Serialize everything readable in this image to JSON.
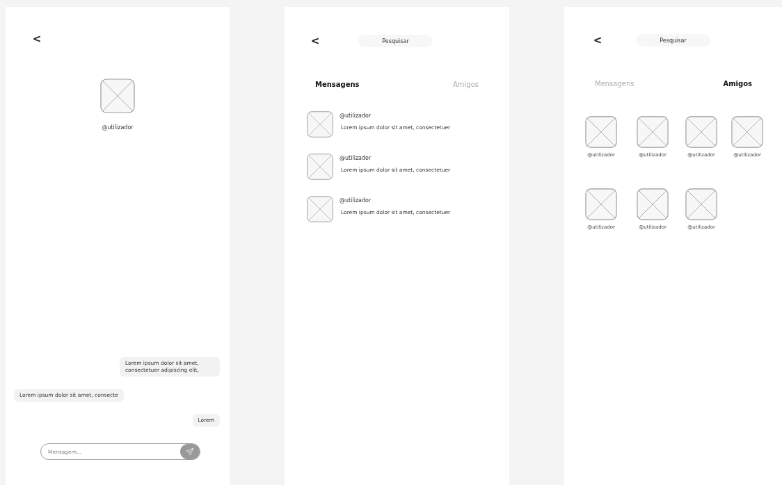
{
  "chat_screen": {
    "back": "<",
    "username": "@utilizador",
    "messages": [
      {
        "text": "Lorem ipsum dolor sit amet, consectetuer adipiscing elit,",
        "outgoing": true
      },
      {
        "text": "Lorem ipsum dolor sit amet, consecte",
        "outgoing": false
      },
      {
        "text": "Lorem",
        "outgoing": true
      }
    ],
    "composer": {
      "placeholder": "Mensagem..."
    }
  },
  "messages_screen": {
    "back": "<",
    "search": {
      "placeholder": "Pesquisar"
    },
    "tabs": [
      {
        "label": "Mensagens",
        "selected": true
      },
      {
        "label": "Amigos",
        "selected": false
      }
    ],
    "conversations": [
      {
        "username": "@utilizador",
        "preview": "Lorem ipsum dolor sit amet, consectetuer"
      },
      {
        "username": "@utilizador",
        "preview": "Lorem ipsum dolor sit amet, consectetuer"
      },
      {
        "username": "@utilizador",
        "preview": "Lorem ipsum dolor sit amet, consectetuer"
      }
    ]
  },
  "friends_screen": {
    "back": "<",
    "search": {
      "placeholder": "Pesquisar"
    },
    "tabs": [
      {
        "label": "Mensagens",
        "selected": false
      },
      {
        "label": "Amigos",
        "selected": true
      }
    ],
    "friends": [
      {
        "username": "@utilizador"
      },
      {
        "username": "@utilizador"
      },
      {
        "username": "@utilizador"
      },
      {
        "username": "@utilizador"
      },
      {
        "username": "@utilizador"
      },
      {
        "username": "@utilizador"
      },
      {
        "username": "@utilizador"
      }
    ]
  }
}
